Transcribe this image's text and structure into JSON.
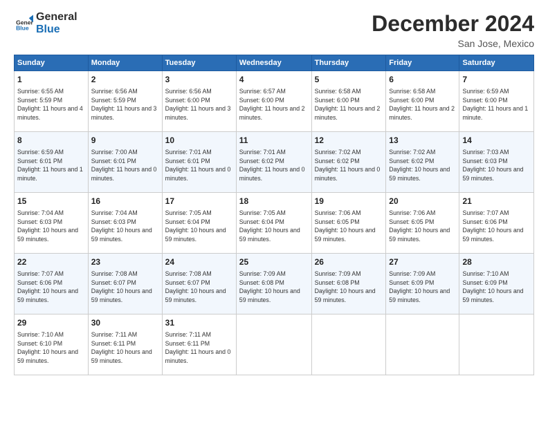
{
  "logo": {
    "line1": "General",
    "line2": "Blue"
  },
  "header": {
    "title": "December 2024",
    "location": "San Jose, Mexico"
  },
  "weekdays": [
    "Sunday",
    "Monday",
    "Tuesday",
    "Wednesday",
    "Thursday",
    "Friday",
    "Saturday"
  ],
  "weeks": [
    [
      {
        "day": "1",
        "info": "Sunrise: 6:55 AM\nSunset: 5:59 PM\nDaylight: 11 hours and 4 minutes."
      },
      {
        "day": "2",
        "info": "Sunrise: 6:56 AM\nSunset: 5:59 PM\nDaylight: 11 hours and 3 minutes."
      },
      {
        "day": "3",
        "info": "Sunrise: 6:56 AM\nSunset: 6:00 PM\nDaylight: 11 hours and 3 minutes."
      },
      {
        "day": "4",
        "info": "Sunrise: 6:57 AM\nSunset: 6:00 PM\nDaylight: 11 hours and 2 minutes."
      },
      {
        "day": "5",
        "info": "Sunrise: 6:58 AM\nSunset: 6:00 PM\nDaylight: 11 hours and 2 minutes."
      },
      {
        "day": "6",
        "info": "Sunrise: 6:58 AM\nSunset: 6:00 PM\nDaylight: 11 hours and 2 minutes."
      },
      {
        "day": "7",
        "info": "Sunrise: 6:59 AM\nSunset: 6:00 PM\nDaylight: 11 hours and 1 minute."
      }
    ],
    [
      {
        "day": "8",
        "info": "Sunrise: 6:59 AM\nSunset: 6:01 PM\nDaylight: 11 hours and 1 minute."
      },
      {
        "day": "9",
        "info": "Sunrise: 7:00 AM\nSunset: 6:01 PM\nDaylight: 11 hours and 0 minutes."
      },
      {
        "day": "10",
        "info": "Sunrise: 7:01 AM\nSunset: 6:01 PM\nDaylight: 11 hours and 0 minutes."
      },
      {
        "day": "11",
        "info": "Sunrise: 7:01 AM\nSunset: 6:02 PM\nDaylight: 11 hours and 0 minutes."
      },
      {
        "day": "12",
        "info": "Sunrise: 7:02 AM\nSunset: 6:02 PM\nDaylight: 11 hours and 0 minutes."
      },
      {
        "day": "13",
        "info": "Sunrise: 7:02 AM\nSunset: 6:02 PM\nDaylight: 10 hours and 59 minutes."
      },
      {
        "day": "14",
        "info": "Sunrise: 7:03 AM\nSunset: 6:03 PM\nDaylight: 10 hours and 59 minutes."
      }
    ],
    [
      {
        "day": "15",
        "info": "Sunrise: 7:04 AM\nSunset: 6:03 PM\nDaylight: 10 hours and 59 minutes."
      },
      {
        "day": "16",
        "info": "Sunrise: 7:04 AM\nSunset: 6:03 PM\nDaylight: 10 hours and 59 minutes."
      },
      {
        "day": "17",
        "info": "Sunrise: 7:05 AM\nSunset: 6:04 PM\nDaylight: 10 hours and 59 minutes."
      },
      {
        "day": "18",
        "info": "Sunrise: 7:05 AM\nSunset: 6:04 PM\nDaylight: 10 hours and 59 minutes."
      },
      {
        "day": "19",
        "info": "Sunrise: 7:06 AM\nSunset: 6:05 PM\nDaylight: 10 hours and 59 minutes."
      },
      {
        "day": "20",
        "info": "Sunrise: 7:06 AM\nSunset: 6:05 PM\nDaylight: 10 hours and 59 minutes."
      },
      {
        "day": "21",
        "info": "Sunrise: 7:07 AM\nSunset: 6:06 PM\nDaylight: 10 hours and 59 minutes."
      }
    ],
    [
      {
        "day": "22",
        "info": "Sunrise: 7:07 AM\nSunset: 6:06 PM\nDaylight: 10 hours and 59 minutes."
      },
      {
        "day": "23",
        "info": "Sunrise: 7:08 AM\nSunset: 6:07 PM\nDaylight: 10 hours and 59 minutes."
      },
      {
        "day": "24",
        "info": "Sunrise: 7:08 AM\nSunset: 6:07 PM\nDaylight: 10 hours and 59 minutes."
      },
      {
        "day": "25",
        "info": "Sunrise: 7:09 AM\nSunset: 6:08 PM\nDaylight: 10 hours and 59 minutes."
      },
      {
        "day": "26",
        "info": "Sunrise: 7:09 AM\nSunset: 6:08 PM\nDaylight: 10 hours and 59 minutes."
      },
      {
        "day": "27",
        "info": "Sunrise: 7:09 AM\nSunset: 6:09 PM\nDaylight: 10 hours and 59 minutes."
      },
      {
        "day": "28",
        "info": "Sunrise: 7:10 AM\nSunset: 6:09 PM\nDaylight: 10 hours and 59 minutes."
      }
    ],
    [
      {
        "day": "29",
        "info": "Sunrise: 7:10 AM\nSunset: 6:10 PM\nDaylight: 10 hours and 59 minutes."
      },
      {
        "day": "30",
        "info": "Sunrise: 7:11 AM\nSunset: 6:11 PM\nDaylight: 10 hours and 59 minutes."
      },
      {
        "day": "31",
        "info": "Sunrise: 7:11 AM\nSunset: 6:11 PM\nDaylight: 11 hours and 0 minutes."
      },
      null,
      null,
      null,
      null
    ]
  ]
}
